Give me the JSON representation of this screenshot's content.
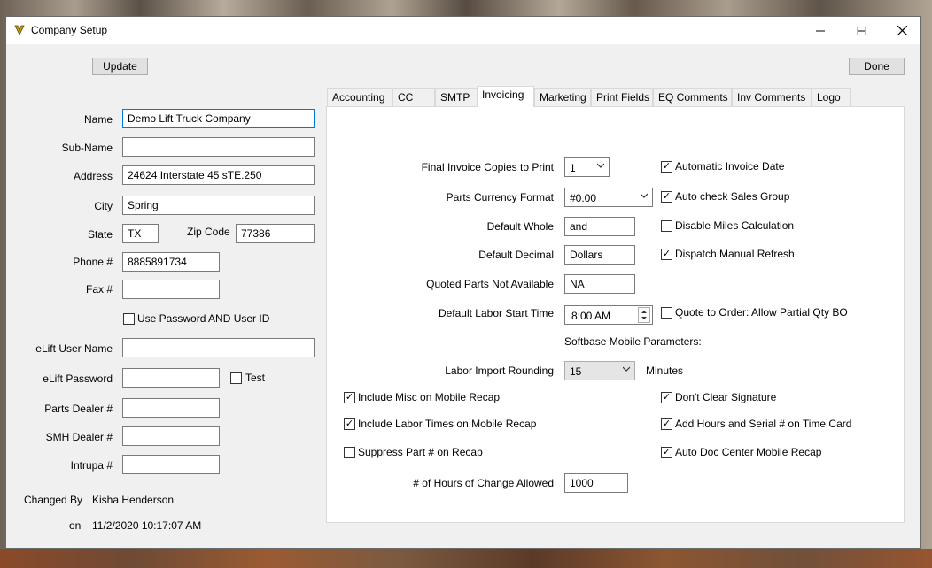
{
  "window": {
    "title": "Company Setup"
  },
  "titlebar": {
    "minimize": "—",
    "maximize": "☐",
    "close": "✕"
  },
  "toolbar": {
    "update_label": "Update",
    "done_label": "Done"
  },
  "company": {
    "name_label": "Name",
    "name_value": "Demo Lift Truck Company",
    "subname_label": "Sub-Name",
    "subname_value": "",
    "address_label": "Address",
    "address_value": "24624 Interstate 45 sTE.250",
    "city_label": "City",
    "city_value": "Spring",
    "state_label": "State",
    "state_value": "TX",
    "zip_label": "Zip Code",
    "zip_value": "77386",
    "phone_label": "Phone #",
    "phone_value": "8885891734",
    "fax_label": "Fax #",
    "fax_value": "",
    "use_password_label": "Use Password AND User ID",
    "use_password_checked": false,
    "elift_user_label": "eLift User Name",
    "elift_user_value": "",
    "elift_password_label": "eLift Password",
    "elift_password_value": "",
    "test_label": "Test",
    "test_checked": false,
    "parts_dealer_label": "Parts Dealer #",
    "parts_dealer_value": "",
    "smh_dealer_label": "SMH Dealer #",
    "smh_dealer_value": "",
    "intrupa_label": "Intrupa #",
    "intrupa_value": "",
    "changed_by_label": "Changed By",
    "changed_by_value": "Kisha Henderson",
    "on_label": "on",
    "on_value": "11/2/2020 10:17:07 AM"
  },
  "tabs": [
    {
      "label": "Accounting"
    },
    {
      "label": "CC"
    },
    {
      "label": "SMTP"
    },
    {
      "label": "Invoicing"
    },
    {
      "label": "Marketing"
    },
    {
      "label": "Print Fields"
    },
    {
      "label": "EQ Comments"
    },
    {
      "label": "Inv Comments"
    },
    {
      "label": "Logo"
    }
  ],
  "active_tab": "Invoicing",
  "invoicing": {
    "final_copies_label": "Final Invoice Copies to Print",
    "final_copies_value": "1",
    "currency_label": "Parts Currency Format",
    "currency_value": "#0.00",
    "default_whole_label": "Default Whole",
    "default_whole_value": "and",
    "default_decimal_label": "Default Decimal",
    "default_decimal_value": "Dollars",
    "quoted_na_label": "Quoted Parts Not Available",
    "quoted_na_value": "NA",
    "labor_start_label": "Default Labor Start Time",
    "labor_start_value": "8:00 AM",
    "mobile_params_label": "Softbase Mobile Parameters:",
    "labor_rounding_label": "Labor Import Rounding",
    "labor_rounding_value": "15",
    "minutes_label": "Minutes",
    "hours_change_label": "# of Hours of Change Allowed",
    "hours_change_value": "1000",
    "checks": {
      "auto_invoice_date": {
        "label": "Automatic Invoice Date",
        "checked": true
      },
      "auto_check_sales": {
        "label": "Auto check Sales Group",
        "checked": true
      },
      "disable_miles": {
        "label": "Disable Miles Calculation",
        "checked": false
      },
      "dispatch_refresh": {
        "label": "Dispatch Manual Refresh",
        "checked": true
      },
      "quote_to_order": {
        "label": "Quote to Order: Allow Partial Qty BO",
        "checked": false
      },
      "include_misc": {
        "label": "Include Misc on Mobile Recap",
        "checked": true
      },
      "include_labor": {
        "label": "Include Labor Times on Mobile Recap",
        "checked": true
      },
      "suppress_part": {
        "label": "Suppress Part # on Recap",
        "checked": false
      },
      "dont_clear_sig": {
        "label": "Don't Clear Signature",
        "checked": true
      },
      "add_hours_serial": {
        "label": "Add Hours and Serial # on Time Card",
        "checked": true
      },
      "auto_doc_center": {
        "label": "Auto Doc Center Mobile Recap",
        "checked": true
      }
    }
  },
  "colors": {
    "accent": "#0078d7",
    "window_bg": "#f0f0f0",
    "panel_bg": "#ffffff"
  }
}
